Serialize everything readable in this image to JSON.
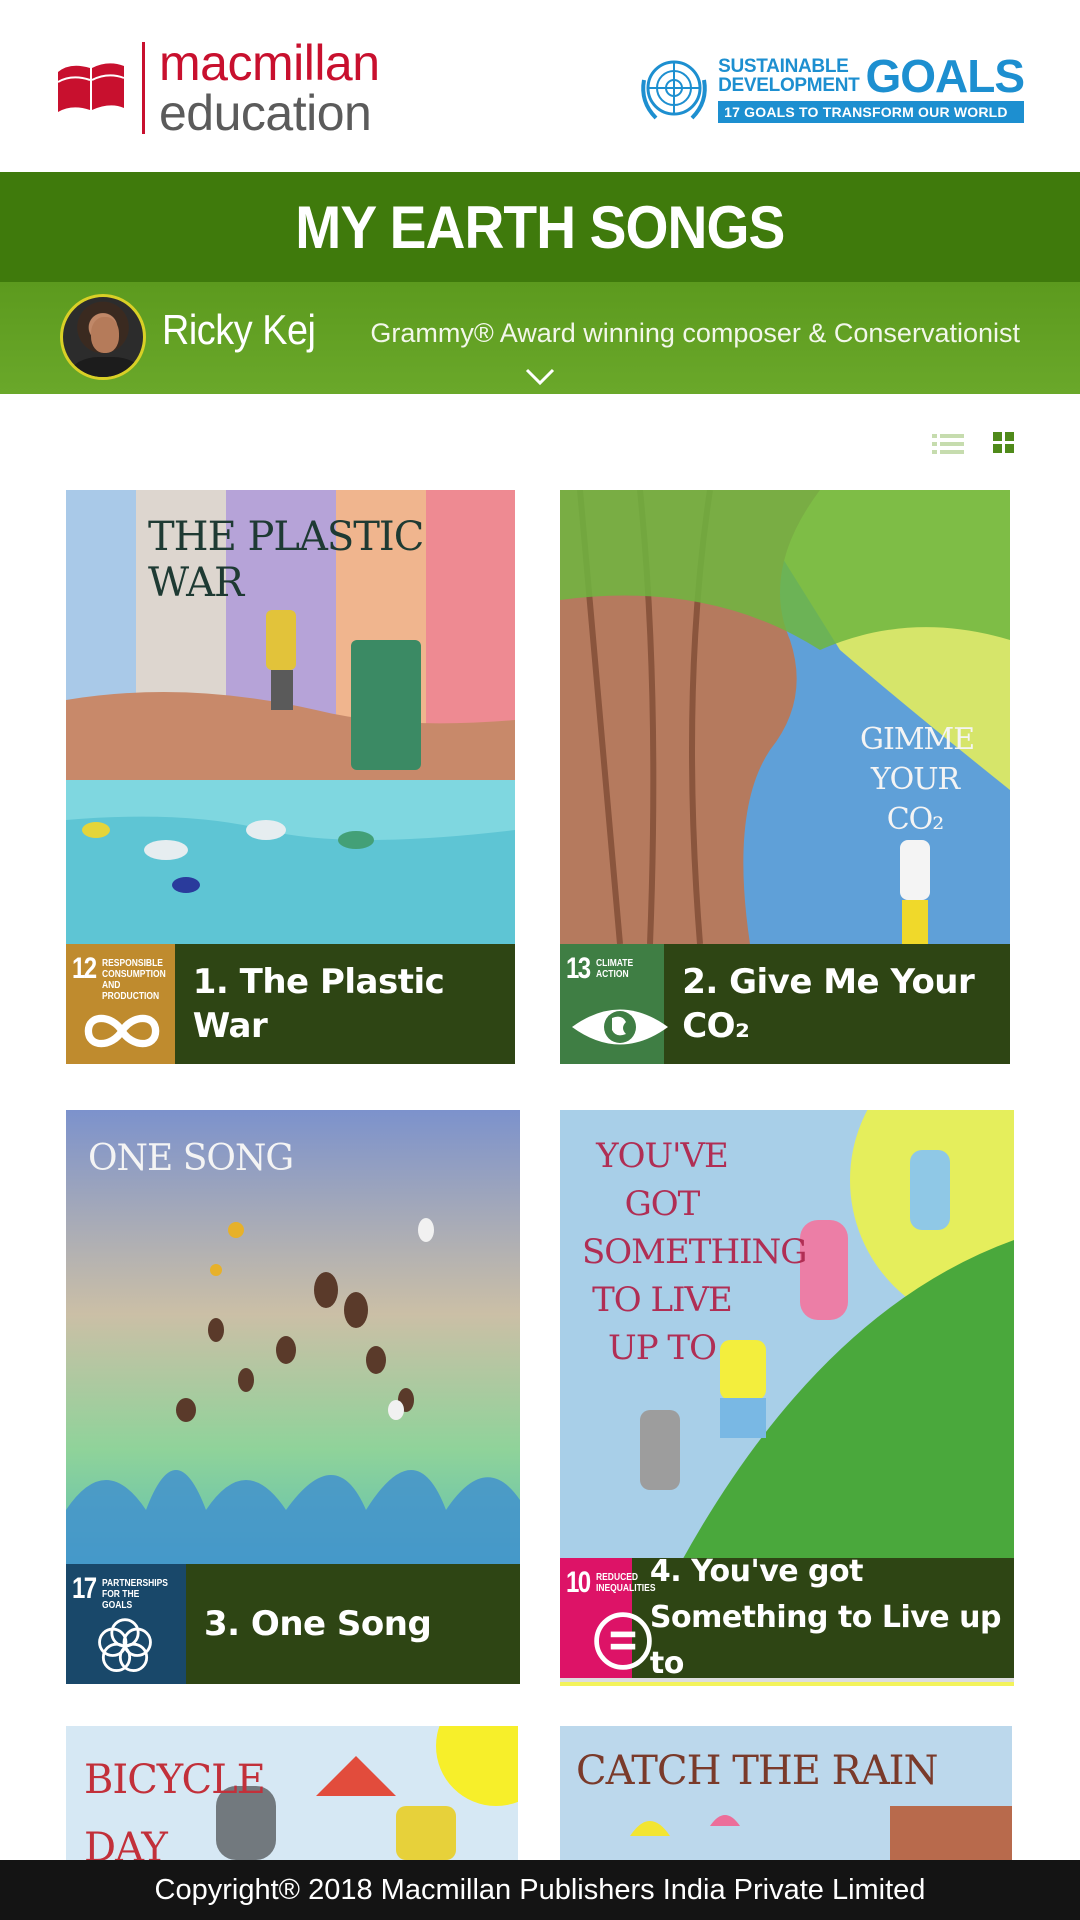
{
  "header": {
    "publisher_logo": {
      "line1": "macmillan",
      "line2": "education"
    },
    "sdg_logo": {
      "line1": "SUSTAINABLE",
      "line2": "DEVELOPMENT",
      "goals": "GOALS",
      "band": "17 GOALS TO TRANSFORM OUR WORLD"
    }
  },
  "page_title": "MY EARTH SONGS",
  "artist": {
    "name": "Ricky Kej",
    "tagline": "Grammy® Award winning composer & Conservationist"
  },
  "view_toggle": {
    "list_icon": "list-icon",
    "grid_icon": "grid-icon",
    "active": "grid"
  },
  "songs": [
    {
      "title": "1. The Plastic War",
      "art_text": "THE PLASTIC WAR",
      "sdg_number": "12",
      "sdg_label": "RESPONSIBLE CONSUMPTION AND PRODUCTION",
      "sdg_color": "#bf8b2e",
      "sdg_icon": "infinity-icon"
    },
    {
      "title": "2. Give Me Your CO₂",
      "art_text": "GIMME YOUR CO₂",
      "sdg_number": "13",
      "sdg_label": "CLIMATE ACTION",
      "sdg_color": "#3f7e44",
      "sdg_icon": "eye-globe-icon"
    },
    {
      "title": "3. One Song",
      "art_text": "ONE SONG",
      "sdg_number": "17",
      "sdg_label": "PARTNERSHIPS FOR THE GOALS",
      "sdg_color": "#19486a",
      "sdg_icon": "flower-rings-icon"
    },
    {
      "title": "4. You've got Something to Live up to",
      "art_text": "YOU'VE GOT SOMETHING TO LIVE UP TO",
      "sdg_number": "10",
      "sdg_label": "REDUCED INEQUALITIES",
      "sdg_color": "#dd1367",
      "sdg_icon": "equals-circle-icon"
    },
    {
      "title": "",
      "art_text": "BICYCLE DAY"
    },
    {
      "title": "",
      "art_text": "CATCH THE RAIN"
    }
  ],
  "footer": {
    "copyright": "Copyright® 2018 Macmillan Publishers India Private Limited"
  }
}
